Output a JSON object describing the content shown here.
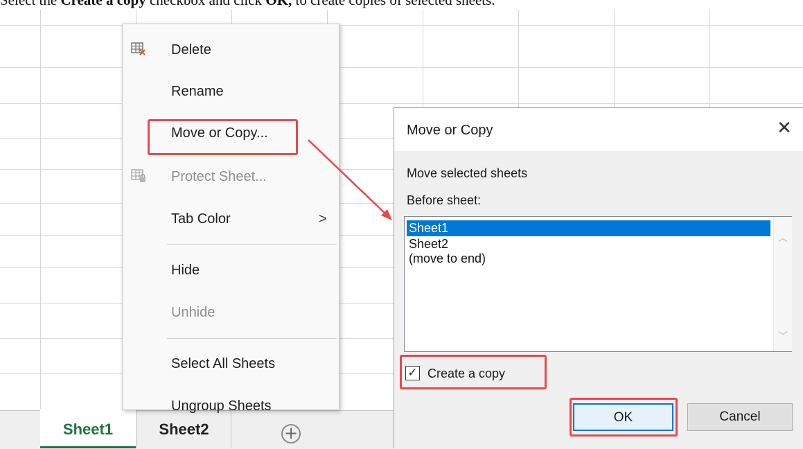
{
  "instruction": {
    "prefix": "Select the ",
    "bold1": "Create a copy",
    "middle": " checkbox and click ",
    "bold2": "OK,",
    "suffix": " to create copies of selected sheets."
  },
  "sheet_tabs": {
    "active": "Sheet1",
    "second": "Sheet2",
    "add_icon": "plus-circle-icon"
  },
  "context_menu": {
    "items": [
      {
        "label": "Delete",
        "enabled": true,
        "icon": "delete-sheet-icon"
      },
      {
        "label": "Rename",
        "enabled": true
      },
      {
        "label": "Move or Copy...",
        "enabled": true,
        "highlighted": true
      },
      {
        "label": "Protect Sheet...",
        "enabled": false,
        "icon": "protect-sheet-icon"
      },
      {
        "label": "Tab Color",
        "enabled": true,
        "submenu": "chevron-right-icon"
      },
      {
        "label": "Hide",
        "enabled": true
      },
      {
        "label": "Unhide",
        "enabled": false
      },
      {
        "label": "Select All Sheets",
        "enabled": true
      },
      {
        "label": "Ungroup Sheets",
        "enabled": true
      }
    ],
    "chevron": ">"
  },
  "dialog": {
    "title": "Move or Copy",
    "close_glyph": "✕",
    "move_label": "Move selected sheets",
    "before_label": "Before sheet:",
    "list_items": [
      "Sheet1",
      "Sheet2",
      "(move to end)"
    ],
    "selected_index": 0,
    "checkbox_label": "Create a copy",
    "checkbox_checked": true,
    "check_glyph": "✓",
    "ok_label": "OK",
    "cancel_label": "Cancel"
  },
  "colors": {
    "accent_green": "#217346",
    "highlight_red": "#e8484d",
    "selection_blue": "#0078d7"
  }
}
